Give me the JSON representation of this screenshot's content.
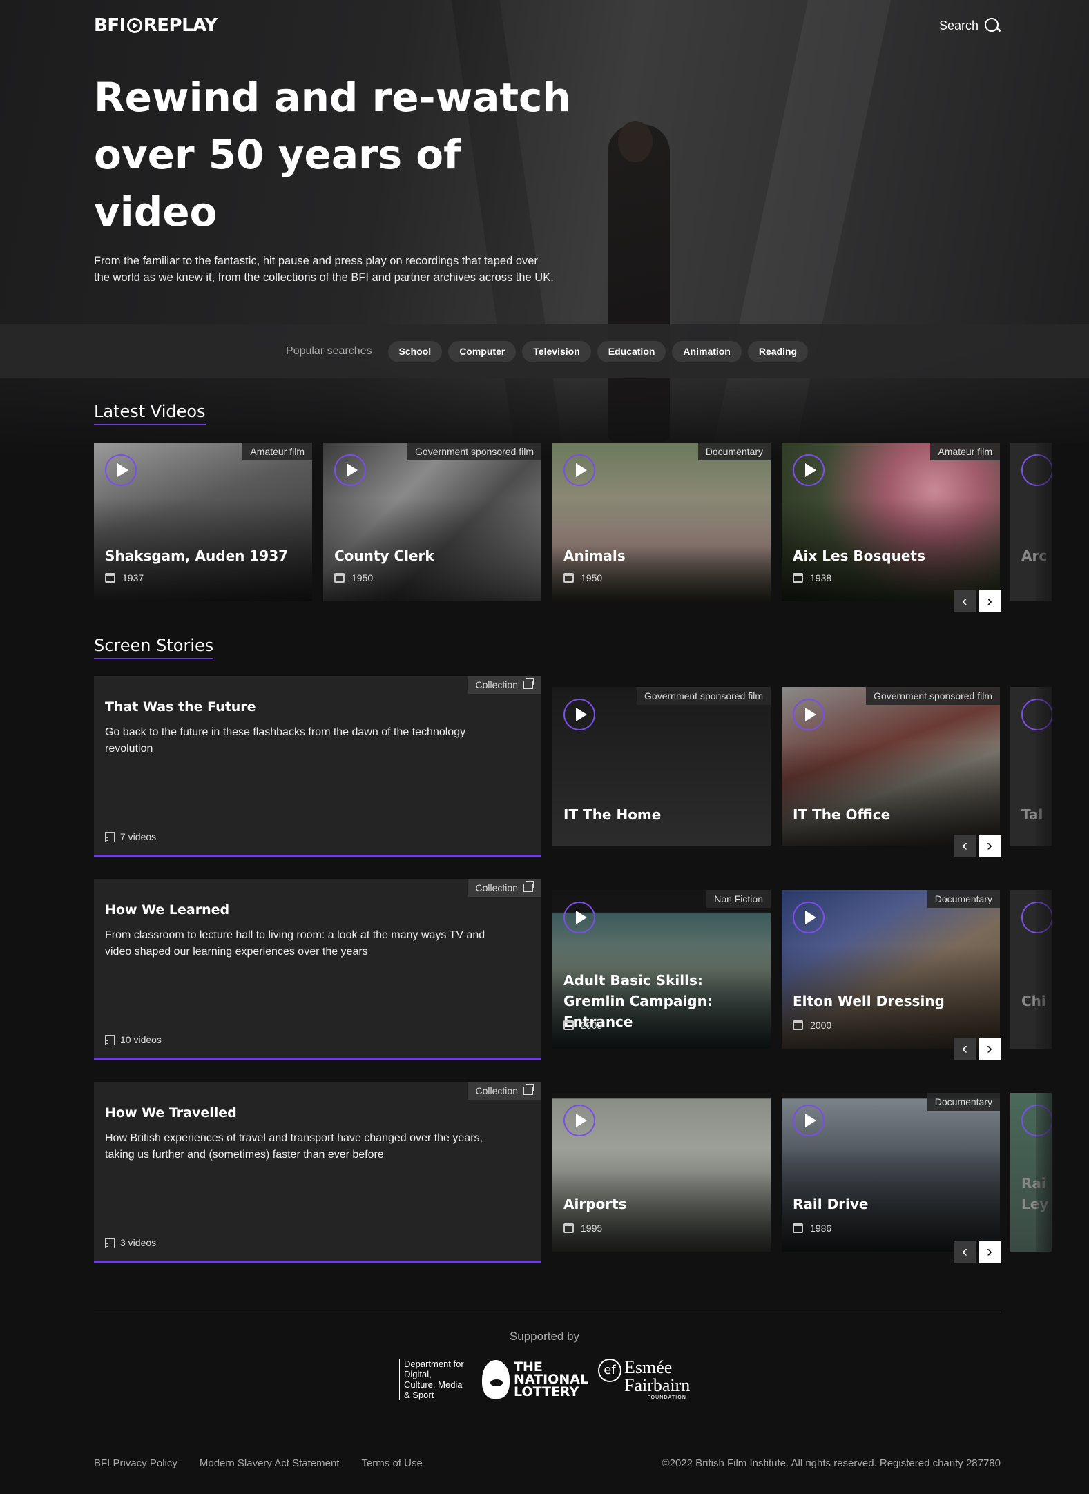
{
  "header": {
    "logo_text": "BFI REPLAY",
    "logo_part1": "BFI",
    "logo_part2": "REPLAY",
    "search_label": "Search"
  },
  "hero": {
    "title": "Rewind and re-watch over 50 years of video",
    "description": "From the familiar to the fantastic, hit pause and press play on recordings that taped over the world as we knew it, from the collections of the BFI and partner archives across the UK."
  },
  "popular": {
    "label": "Popular searches",
    "items": [
      "School",
      "Computer",
      "Television",
      "Education",
      "Animation",
      "Reading"
    ]
  },
  "latest": {
    "heading": "Latest Videos",
    "videos": [
      {
        "title": "Shaksgam, Auden 1937",
        "year": "1937",
        "tag": "Amateur film"
      },
      {
        "title": "County Clerk",
        "year": "1950",
        "tag": "Government sponsored film"
      },
      {
        "title": "Animals",
        "year": "1950",
        "tag": "Documentary"
      },
      {
        "title": "Aix Les Bosquets",
        "year": "1938",
        "tag": "Amateur film"
      }
    ],
    "peek_title": "Arc"
  },
  "stories": {
    "heading": "Screen Stories",
    "collection_tag": "Collection",
    "collections": [
      {
        "title": "That Was the Future",
        "description": "Go back to the future in these flashbacks from the dawn of the technology revolution",
        "count": "7 videos",
        "videos": [
          {
            "title": "IT The Home",
            "tag": "Government sponsored film"
          },
          {
            "title": "IT The Office",
            "tag": "Government sponsored film"
          }
        ],
        "peek_title": "Tal"
      },
      {
        "title": "How We Learned",
        "description": "From classroom to lecture hall to living room: a look at the many ways TV and video shaped our learning experiences over the years",
        "count": "10 videos",
        "videos": [
          {
            "title": "Adult Basic Skills: Gremlin Campaign: Entrance",
            "year": "2003",
            "tag": "Non Fiction"
          },
          {
            "title": "Elton Well Dressing",
            "year": "2000",
            "tag": "Documentary"
          }
        ],
        "peek_title": "Chi"
      },
      {
        "title": "How We Travelled",
        "description": "How British experiences of travel and transport have changed over the years, taking us further and (sometimes) faster than ever before",
        "count": "3 videos",
        "videos": [
          {
            "title": "Airports",
            "year": "1995",
            "tag": ""
          },
          {
            "title": "Rail Drive",
            "year": "1986",
            "tag": "Documentary"
          }
        ],
        "peek_title": "Rai Ley"
      }
    ]
  },
  "footer": {
    "supported_by": "Supported by",
    "sponsors": {
      "dcms": "Department for Digital, Culture, Media & Sport",
      "lottery": "THE NATIONAL LOTTERY",
      "esmee_name": "Esmée Fairbairn",
      "esmee_sub": "FOUNDATION",
      "esmee_mark": "ef"
    },
    "links": [
      "BFI Privacy Policy",
      "Modern Slavery Act Statement",
      "Terms of Use"
    ],
    "copyright": "©2022 British Film Institute. All rights reserved. Registered charity 287780"
  },
  "colors": {
    "accent": "#6d3fd6",
    "background": "#111112"
  }
}
